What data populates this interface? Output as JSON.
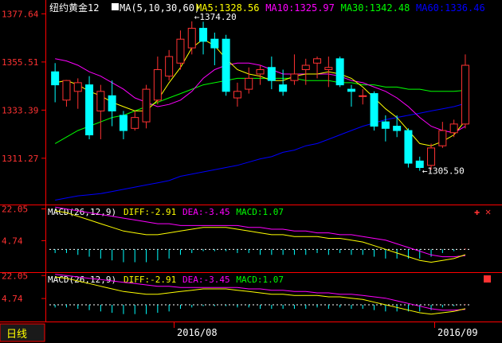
{
  "window": {
    "instrument": "纽约黄金12",
    "period_tab": "日线",
    "bottom_dates": [
      "2016/08",
      "2016/09"
    ]
  },
  "colors": {
    "up": "#ff3232",
    "down": "#00ffff",
    "ma5": "#ffff00",
    "ma10": "#ff00ff",
    "ma30": "#00ff00",
    "ma60": "#0000ff",
    "diff": "#ffff00",
    "dea": "#ff00ff",
    "axis": "#ff0000",
    "tick_text": "#ff3232"
  },
  "chart_data": [
    {
      "type": "candlestick",
      "title": "纽约黄金12",
      "indicator_label": "MA(5,10,30,60)",
      "legend": [
        {
          "name": "MA5",
          "value": "1328.56",
          "color": "#ffff00"
        },
        {
          "name": "MA10",
          "value": "1325.97",
          "color": "#ff00ff"
        },
        {
          "name": "MA30",
          "value": "1342.48",
          "color": "#00ff00"
        },
        {
          "name": "MA60",
          "value": "1336.46",
          "color": "#0000ff"
        }
      ],
      "yticks": [
        "1377.64",
        "1355.51",
        "1333.39",
        "1311.27"
      ],
      "ylim": [
        1290,
        1384
      ],
      "annotations": [
        {
          "text": "1374.20",
          "bar": 12
        },
        {
          "text": "1305.50",
          "bar": 32
        }
      ],
      "candles": [
        {
          "o": 1351,
          "h": 1355,
          "c": 1345,
          "l": 1337
        },
        {
          "o": 1338,
          "h": 1342,
          "c": 1347,
          "l": 1335
        },
        {
          "o": 1342,
          "h": 1348,
          "c": 1346,
          "l": 1334
        },
        {
          "o": 1345,
          "h": 1349,
          "c": 1322,
          "l": 1320
        },
        {
          "o": 1333,
          "h": 1345,
          "c": 1342,
          "l": 1320
        },
        {
          "o": 1340,
          "h": 1347,
          "c": 1333,
          "l": 1326
        },
        {
          "o": 1331,
          "h": 1333,
          "c": 1324,
          "l": 1320
        },
        {
          "o": 1325,
          "h": 1333,
          "c": 1330,
          "l": 1324
        },
        {
          "o": 1328,
          "h": 1345,
          "c": 1343,
          "l": 1325
        },
        {
          "o": 1338,
          "h": 1358,
          "c": 1352,
          "l": 1336
        },
        {
          "o": 1349,
          "h": 1361,
          "c": 1358,
          "l": 1347
        },
        {
          "o": 1355,
          "h": 1370,
          "c": 1366,
          "l": 1352
        },
        {
          "o": 1362,
          "h": 1374.2,
          "c": 1371,
          "l": 1359
        },
        {
          "o": 1371,
          "h": 1374,
          "c": 1365,
          "l": 1359
        },
        {
          "o": 1366,
          "h": 1369,
          "c": 1362,
          "l": 1354
        },
        {
          "o": 1366,
          "h": 1368,
          "c": 1342,
          "l": 1340
        },
        {
          "o": 1339,
          "h": 1346,
          "c": 1342,
          "l": 1335
        },
        {
          "o": 1343,
          "h": 1353,
          "c": 1348,
          "l": 1341
        },
        {
          "o": 1350,
          "h": 1354,
          "c": 1352,
          "l": 1345
        },
        {
          "o": 1353,
          "h": 1358,
          "c": 1347,
          "l": 1343
        },
        {
          "o": 1345,
          "h": 1352,
          "c": 1342,
          "l": 1340
        },
        {
          "o": 1347,
          "h": 1359,
          "c": 1350,
          "l": 1345
        },
        {
          "o": 1352,
          "h": 1357,
          "c": 1354,
          "l": 1345
        },
        {
          "o": 1355,
          "h": 1358,
          "c": 1357,
          "l": 1348
        },
        {
          "o": 1352,
          "h": 1358,
          "c": 1353,
          "l": 1344
        },
        {
          "o": 1357,
          "h": 1358,
          "c": 1345,
          "l": 1344
        },
        {
          "o": 1343,
          "h": 1345,
          "c": 1342,
          "l": 1335
        },
        {
          "o": 1340,
          "h": 1343,
          "c": 1340,
          "l": 1336
        },
        {
          "o": 1341,
          "h": 1342,
          "c": 1326,
          "l": 1324
        },
        {
          "o": 1328,
          "h": 1331,
          "c": 1325,
          "l": 1319
        },
        {
          "o": 1326,
          "h": 1331,
          "c": 1324,
          "l": 1321
        },
        {
          "o": 1324,
          "h": 1325,
          "c": 1309,
          "l": 1307
        },
        {
          "o": 1310,
          "h": 1312,
          "c": 1307,
          "l": 1305.5
        },
        {
          "o": 1308,
          "h": 1318,
          "c": 1316,
          "l": 1306
        },
        {
          "o": 1317,
          "h": 1328,
          "c": 1324,
          "l": 1316
        },
        {
          "o": 1323,
          "h": 1329,
          "c": 1327,
          "l": 1321
        },
        {
          "o": 1327,
          "h": 1359,
          "c": 1354,
          "l": 1325
        }
      ],
      "ma5": [
        1346,
        1347,
        1345,
        1342,
        1340,
        1337,
        1335,
        1333,
        1333,
        1338,
        1346,
        1353,
        1362,
        1366,
        1363,
        1357,
        1352,
        1350,
        1349,
        1347,
        1347,
        1349,
        1350,
        1350,
        1351,
        1350,
        1348,
        1344,
        1339,
        1334,
        1330,
        1324,
        1318,
        1317,
        1319,
        1322,
        1328.56
      ],
      "ma10": [
        1357,
        1356,
        1354,
        1351,
        1349,
        1346,
        1343,
        1339,
        1337,
        1335,
        1336,
        1338,
        1342,
        1348,
        1352,
        1354,
        1355,
        1355,
        1354,
        1352,
        1350,
        1350,
        1350,
        1350,
        1350,
        1349,
        1347,
        1346,
        1344,
        1342,
        1339,
        1335,
        1330,
        1326,
        1324,
        1323,
        1325.97
      ],
      "ma30": [
        1318,
        1321,
        1324,
        1326,
        1328,
        1330,
        1331,
        1333,
        1335,
        1337,
        1339,
        1341,
        1343,
        1345,
        1346,
        1347,
        1348,
        1348,
        1348,
        1348,
        1348,
        1348,
        1347,
        1347,
        1347,
        1346,
        1346,
        1345,
        1345,
        1344,
        1344,
        1343,
        1343,
        1342,
        1342,
        1342,
        1342.48
      ],
      "ma60": [
        1292,
        1293,
        1294,
        1294.5,
        1295,
        1296,
        1297,
        1298,
        1299,
        1300,
        1301,
        1303,
        1304,
        1305,
        1306,
        1307,
        1308,
        1309.5,
        1311,
        1312,
        1314,
        1315,
        1317,
        1318,
        1320,
        1322,
        1324,
        1326,
        1327.5,
        1329,
        1330,
        1331,
        1332,
        1333,
        1334,
        1335,
        1336.46
      ]
    },
    {
      "type": "macd",
      "title": "MACD(26,12,9)",
      "legend": [
        {
          "name": "DIFF",
          "value": "-2.91",
          "color": "#ffff00"
        },
        {
          "name": "DEA",
          "value": "-3.45",
          "color": "#ff00ff"
        },
        {
          "name": "MACD",
          "value": "1.07",
          "color": "#00ff00"
        }
      ],
      "yticks": [
        "22.05",
        "4.74"
      ],
      "ylim": [
        -12,
        24
      ],
      "diff": [
        21,
        20,
        18,
        16,
        14,
        12,
        10,
        9,
        8,
        8,
        9,
        10,
        11,
        12,
        12,
        12,
        11,
        10,
        9,
        8,
        8,
        7,
        7,
        7,
        6,
        6,
        5,
        4,
        2,
        0,
        -2,
        -4,
        -6,
        -7,
        -6,
        -5,
        -2.91
      ],
      "dea": [
        23,
        22,
        21,
        20,
        19,
        18,
        17,
        16,
        15,
        14,
        14,
        13,
        13,
        13,
        13,
        13,
        13,
        12,
        12,
        11,
        11,
        10,
        10,
        9,
        9,
        8,
        8,
        7,
        6,
        5,
        3,
        1,
        -1,
        -3,
        -4,
        -4,
        -3.45
      ]
    },
    {
      "type": "macd",
      "title": "MACD(26,12,9)",
      "legend": [
        {
          "name": "DIFF",
          "value": "-2.91",
          "color": "#ffff00"
        },
        {
          "name": "DEA",
          "value": "-3.45",
          "color": "#ff00ff"
        },
        {
          "name": "MACD",
          "value": "1.07",
          "color": "#00ff00"
        }
      ],
      "yticks": [
        "22.05",
        "4.74"
      ],
      "ylim": [
        -12,
        24
      ],
      "diff": [
        21,
        20,
        18,
        16,
        14,
        12,
        10,
        9,
        8,
        8,
        9,
        10,
        11,
        12,
        12,
        12,
        11,
        10,
        9,
        8,
        8,
        7,
        7,
        7,
        6,
        6,
        5,
        4,
        2,
        0,
        -2,
        -4,
        -6,
        -7,
        -6,
        -5,
        -2.91
      ],
      "dea": [
        23,
        22,
        21,
        20,
        19,
        18,
        17,
        16,
        15,
        14,
        14,
        13,
        13,
        13,
        13,
        13,
        13,
        12,
        12,
        11,
        11,
        10,
        10,
        9,
        9,
        8,
        8,
        7,
        6,
        5,
        3,
        1,
        -1,
        -3,
        -4,
        -4,
        -3.45
      ]
    }
  ]
}
